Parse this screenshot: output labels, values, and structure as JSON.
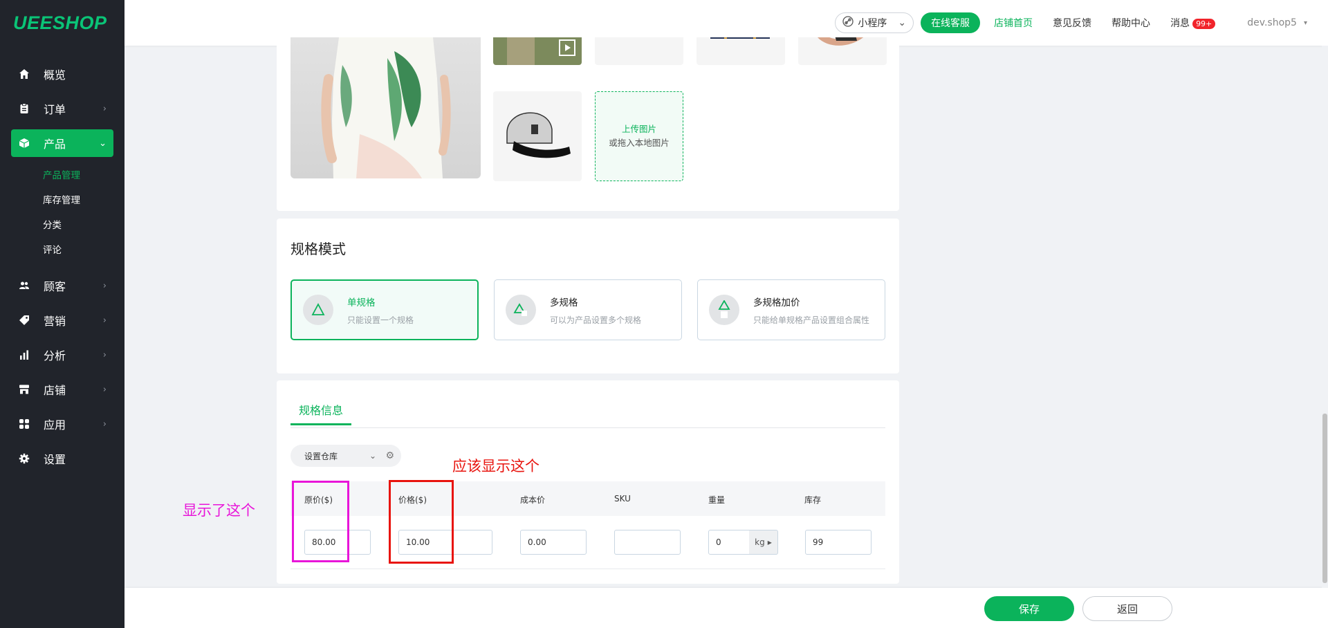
{
  "brand": {
    "logo": "UEESHOP"
  },
  "sidebar": {
    "items": [
      {
        "label": "概览",
        "icon": "home-icon"
      },
      {
        "label": "订单",
        "icon": "clipboard-icon"
      },
      {
        "label": "产品",
        "icon": "box-icon"
      },
      {
        "label": "顾客",
        "icon": "users-icon"
      },
      {
        "label": "营销",
        "icon": "tag-icon"
      },
      {
        "label": "分析",
        "icon": "bar-chart-icon"
      },
      {
        "label": "店铺",
        "icon": "store-icon"
      },
      {
        "label": "应用",
        "icon": "apps-icon"
      },
      {
        "label": "设置",
        "icon": "gear-icon"
      }
    ],
    "product_sub": [
      "产品管理",
      "库存管理",
      "分类",
      "评论"
    ]
  },
  "header": {
    "mini_program": "小程序",
    "online_service": "在线客服",
    "store_home": "店铺首页",
    "feedback": "意见反馈",
    "help": "帮助中心",
    "messages": "消息",
    "messages_badge": "99+",
    "user": "dev.shop5"
  },
  "upload": {
    "line1": "上传图片",
    "line2": "或拖入本地图片"
  },
  "spec_mode": {
    "title": "规格模式",
    "options": [
      {
        "title": "单规格",
        "desc": "只能设置一个规格"
      },
      {
        "title": "多规格",
        "desc": "可以为产品设置多个规格"
      },
      {
        "title": "多规格加价",
        "desc": "只能给单规格产品设置组合属性"
      }
    ]
  },
  "spec_info": {
    "tab": "规格信息",
    "warehouse": "设置仓库",
    "columns": [
      "原价($)",
      "价格($)",
      "成本价",
      "SKU",
      "重量",
      "库存"
    ],
    "values": {
      "original": "80.00",
      "price": "10.00",
      "cost": "0.00",
      "sku": "",
      "weight": "0",
      "weight_unit": "kg",
      "stock": "99"
    }
  },
  "annotations": {
    "shown": "显示了这个",
    "should_show": "应该显示这个"
  },
  "footer": {
    "save": "保存",
    "back": "返回"
  },
  "colors": {
    "accent": "#0bb35b",
    "sidebar": "#21242b",
    "annotation_magenta": "#e815d9",
    "annotation_red": "#e8140e"
  }
}
